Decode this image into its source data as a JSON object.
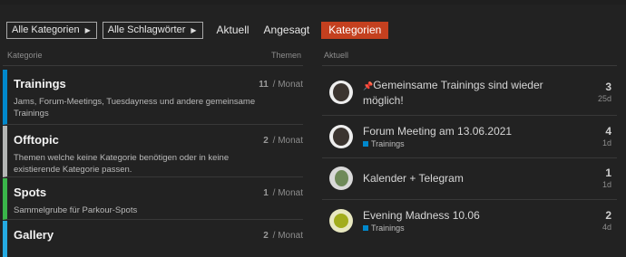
{
  "nav": {
    "dropdown_categories": "Alle Kategorien",
    "dropdown_tags": "Alle Schlagwörter",
    "latest": "Aktuell",
    "top": "Angesagt",
    "categories": "Kategorien",
    "active_color": "#c4401f"
  },
  "headers": {
    "category": "Kategorie",
    "topics": "Themen",
    "latest": "Aktuell"
  },
  "categories": [
    {
      "name": "Trainings",
      "desc": "Jams, Forum-Meetings, Tuesdayness und andere gemeinsame Trainings",
      "count": "11",
      "period": "/ Monat",
      "color": "#0088cc"
    },
    {
      "name": "Offtopic",
      "desc": "Themen welche keine Kategorie benötigen oder in keine existierende Kategorie passen.",
      "count": "2",
      "period": "/ Monat",
      "color": "#b3b5b4"
    },
    {
      "name": "Spots",
      "desc": "Sammelgrube für Parkour-Spots",
      "count": "1",
      "period": "/ Monat",
      "color": "#3ab54a"
    },
    {
      "name": "Gallery",
      "desc": "",
      "count": "2",
      "period": "/ Monat",
      "color": "#25aae2"
    }
  ],
  "topics": [
    {
      "title": "Gemeinsame Trainings sind wieder möglich!",
      "pinned": true,
      "tag": "",
      "replies": "3",
      "age": "25d",
      "avatar": "person-dark-icon"
    },
    {
      "title": "Forum Meeting am 13.06.2021",
      "pinned": false,
      "tag": "Trainings",
      "replies": "4",
      "age": "1d",
      "avatar": "person-dark-icon"
    },
    {
      "title": "Kalender + Telegram",
      "pinned": false,
      "tag": "",
      "replies": "1",
      "age": "1d",
      "avatar": "tree-photo-icon"
    },
    {
      "title": "Evening Madness 10.06",
      "pinned": false,
      "tag": "Trainings",
      "replies": "2",
      "age": "4d",
      "avatar": "green-logo-icon"
    }
  ]
}
